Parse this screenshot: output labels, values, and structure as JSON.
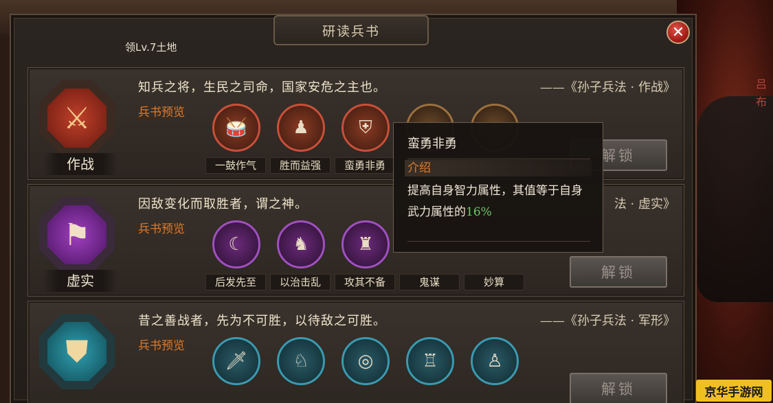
{
  "window": {
    "title": "研读兵书",
    "land_label": "领Lv.7土地",
    "close_glyph": "✕"
  },
  "background": {
    "character_name": "吕布"
  },
  "cards": [
    {
      "id": "zuozhan",
      "badge_name": "作战",
      "badge_colors": [
        "#c0402a",
        "#6a1a10"
      ],
      "badge_glyph": "⚔",
      "quote": "知兵之将，生民之司命，国家安危之主也。",
      "source": "——《孙子兵法 · 作战》",
      "preview_label": "兵书预览",
      "skill_ring_color": "#c8503a",
      "skills": [
        "一鼓作气",
        "胜而益强",
        "蛮勇非勇",
        "",
        "",
        ""
      ],
      "unlock_label": "解锁"
    },
    {
      "id": "xushi",
      "badge_name": "虚实",
      "badge_colors": [
        "#a040c0",
        "#4a1460"
      ],
      "badge_glyph": "⚑",
      "quote": "因敌变化而取胜者，谓之神。",
      "source": "法 · 虚实》",
      "preview_label": "兵书预览",
      "skill_ring_color": "#a050c0",
      "skills": [
        "后发先至",
        "以治击乱",
        "攻其不备",
        "鬼谋",
        "妙算",
        ""
      ],
      "unlock_label": "解锁"
    },
    {
      "id": "junxing",
      "badge_name": "",
      "badge_colors": [
        "#30a0b0",
        "#104a55"
      ],
      "badge_glyph": "⛊",
      "quote": "昔之善战者，先为不可胜，以待敌之可胜。",
      "source": "——《孙子兵法 · 军形》",
      "preview_label": "兵书预览",
      "skill_ring_color": "#3a9ab0",
      "skills": [
        "",
        "",
        "",
        "",
        "",
        ""
      ],
      "unlock_label": "解锁"
    }
  ],
  "tooltip": {
    "title": "蛮勇非勇",
    "intro_label": "介绍",
    "desc_pre": "提高自身智力属性，其值等于自身武力属性的",
    "desc_value": "16%"
  },
  "watermark": "京华手游网"
}
